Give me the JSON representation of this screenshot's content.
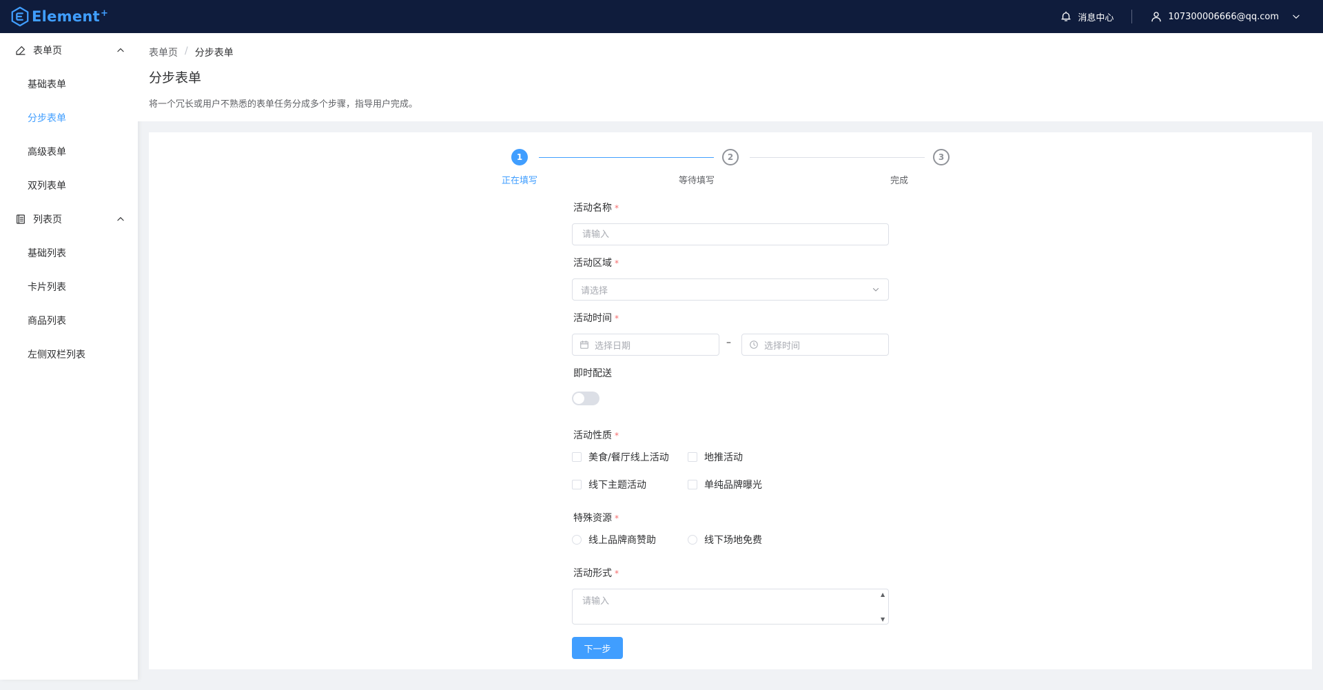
{
  "header": {
    "logo_text": "Element",
    "logo_sup": "+",
    "notice_label": "消息中心",
    "user_email": "107300006666@qq.com"
  },
  "sidebar": {
    "groups": [
      {
        "label": "表单页",
        "icon": "edit-icon",
        "items": [
          {
            "label": "基础表单"
          },
          {
            "label": "分步表单"
          },
          {
            "label": "高级表单"
          },
          {
            "label": "双列表单"
          }
        ]
      },
      {
        "label": "列表页",
        "icon": "list-icon",
        "items": [
          {
            "label": "基础列表"
          },
          {
            "label": "卡片列表"
          },
          {
            "label": "商品列表"
          },
          {
            "label": "左侧双栏列表"
          }
        ]
      }
    ],
    "active_item": "分步表单"
  },
  "breadcrumb": {
    "parent": "表单页",
    "separator": "/",
    "current": "分步表单"
  },
  "page": {
    "title": "分步表单",
    "description": "将一个冗长或用户不熟悉的表单任务分成多个步骤，指导用户完成。"
  },
  "steps": [
    {
      "number": "1",
      "title": "正在填写",
      "status": "process"
    },
    {
      "number": "2",
      "title": "等待填写",
      "status": "wait"
    },
    {
      "number": "3",
      "title": "完成",
      "status": "wait"
    }
  ],
  "form": {
    "required_mark": "*",
    "name": {
      "label": "活动名称",
      "placeholder": "请输入",
      "value": ""
    },
    "region": {
      "label": "活动区域",
      "placeholder": "请选择"
    },
    "time": {
      "label": "活动时间",
      "date_placeholder": "选择日期",
      "time_placeholder": "选择时间",
      "separator": "–"
    },
    "delivery": {
      "label": "即时配送",
      "on": false
    },
    "type": {
      "label": "活动性质",
      "options": [
        {
          "label": "美食/餐厅线上活动",
          "checked": false
        },
        {
          "label": "地推活动",
          "checked": false
        },
        {
          "label": "线下主题活动",
          "checked": false
        },
        {
          "label": "单纯品牌曝光",
          "checked": false
        }
      ]
    },
    "resource": {
      "label": "特殊资源",
      "options": [
        {
          "label": "线上品牌商赞助",
          "checked": false
        },
        {
          "label": "线下场地免费",
          "checked": false
        }
      ]
    },
    "desc": {
      "label": "活动形式",
      "placeholder": "请输入",
      "value": ""
    },
    "next_button": "下一步"
  },
  "colors": {
    "primary": "#409eff",
    "header_bg": "#0f1c3c",
    "required": "#f56c6c"
  }
}
